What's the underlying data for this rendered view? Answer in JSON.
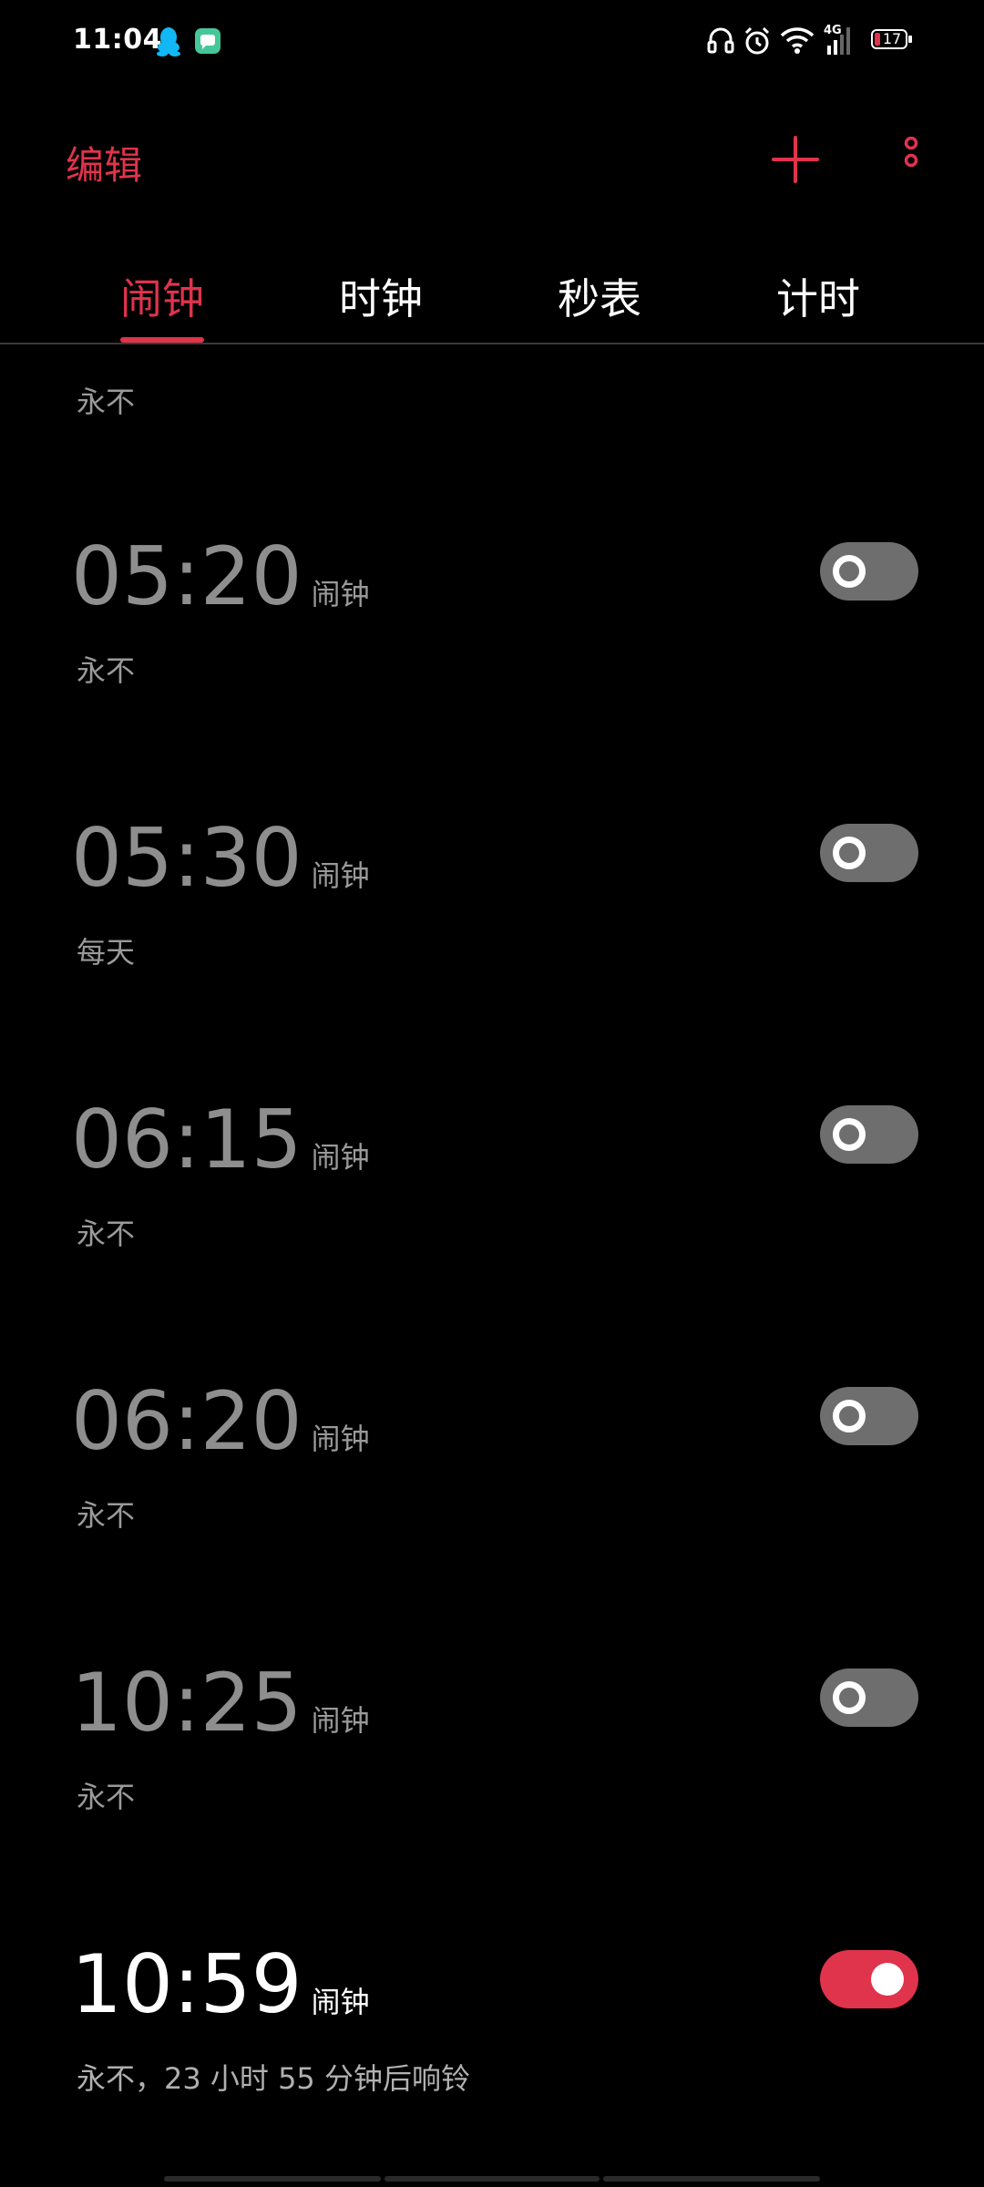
{
  "status_bar": {
    "time": "11:04",
    "battery": "17",
    "network": "4G",
    "left_icons": [
      "qq-icon",
      "message-icon"
    ],
    "right_icons": [
      "headset-icon",
      "alarm-icon",
      "wifi-icon",
      "signal-icon",
      "battery-icon"
    ]
  },
  "toolbar": {
    "edit_label": "编辑",
    "add_icon": "plus-icon",
    "more_icon": "more-vertical-icon",
    "accent_color": "#e0334c"
  },
  "tabs": [
    {
      "label": "闹钟",
      "active": true
    },
    {
      "label": "时钟",
      "active": false
    },
    {
      "label": "秒表",
      "active": false
    },
    {
      "label": "计时",
      "active": false
    }
  ],
  "partial_item": {
    "repeat": "永不"
  },
  "alarms": [
    {
      "time": "05:20",
      "label": "闹钟",
      "repeat": "永不",
      "enabled": false
    },
    {
      "time": "05:30",
      "label": "闹钟",
      "repeat": "每天",
      "enabled": false
    },
    {
      "time": "06:15",
      "label": "闹钟",
      "repeat": "永不",
      "enabled": false
    },
    {
      "time": "06:20",
      "label": "闹钟",
      "repeat": "永不",
      "enabled": false
    },
    {
      "time": "10:25",
      "label": "闹钟",
      "repeat": "永不",
      "enabled": false
    },
    {
      "time": "10:59",
      "label": "闹钟",
      "repeat": "永不，23 小时 55 分钟后响铃",
      "enabled": true
    }
  ]
}
